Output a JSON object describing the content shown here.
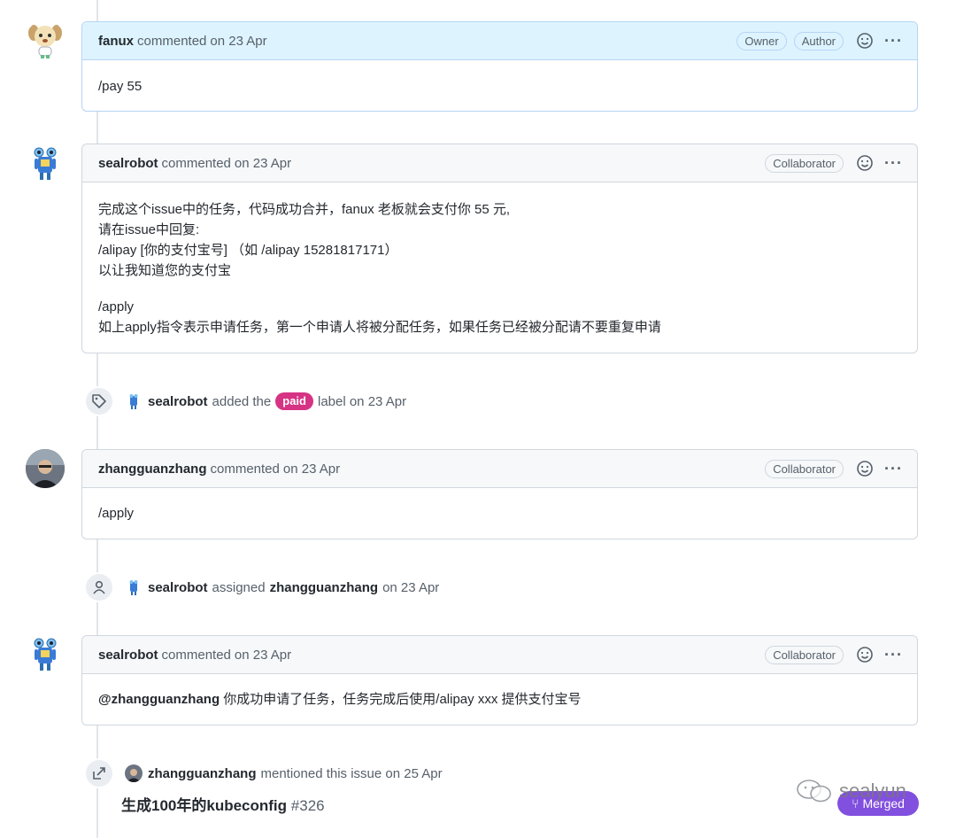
{
  "comments": [
    {
      "author": "fanux",
      "action": "commented",
      "date": "on 23 Apr",
      "badges": [
        "Owner",
        "Author"
      ],
      "lines": [
        "/pay 55"
      ]
    },
    {
      "author": "sealrobot",
      "action": "commented",
      "date": "on 23 Apr",
      "badges": [
        "Collaborator"
      ],
      "lines": [
        "完成这个issue中的任务，代码成功合并，fanux 老板就会支付你 55 元,",
        "请在issue中回复:",
        "/alipay [你的支付宝号] （如 /alipay 15281817171）",
        "以让我知道您的支付宝",
        "/apply",
        "如上apply指令表示申请任务，第一个申请人将被分配任务，如果任务已经被分配请不要重复申请"
      ]
    },
    {
      "author": "zhangguanzhang",
      "action": "commented",
      "date": "on 23 Apr",
      "badges": [
        "Collaborator"
      ],
      "lines": [
        "/apply"
      ]
    },
    {
      "author": "sealrobot",
      "action": "commented",
      "date": "on 23 Apr",
      "badges": [
        "Collaborator"
      ],
      "mention": "@zhangguanzhang",
      "lines": [
        " 你成功申请了任务，任务完成后使用/alipay xxx 提供支付宝号"
      ]
    }
  ],
  "events": {
    "label": {
      "actor": "sealrobot",
      "text1": "added the",
      "label": "paid",
      "text2": "label on 23 Apr"
    },
    "assign": {
      "actor": "sealrobot",
      "text1": "assigned",
      "assignee": "zhangguanzhang",
      "text2": "on 23 Apr"
    },
    "mention": {
      "actor": "zhangguanzhang",
      "text1": "mentioned this issue on 25 Apr",
      "ref_title": "生成100年的kubeconfig",
      "ref_number": "#326",
      "status": "Merged"
    }
  },
  "watermark": "sealyun",
  "colors": {
    "paid_label": "#d63384",
    "merged": "#8250df",
    "owner_header": "#ddf4ff"
  }
}
